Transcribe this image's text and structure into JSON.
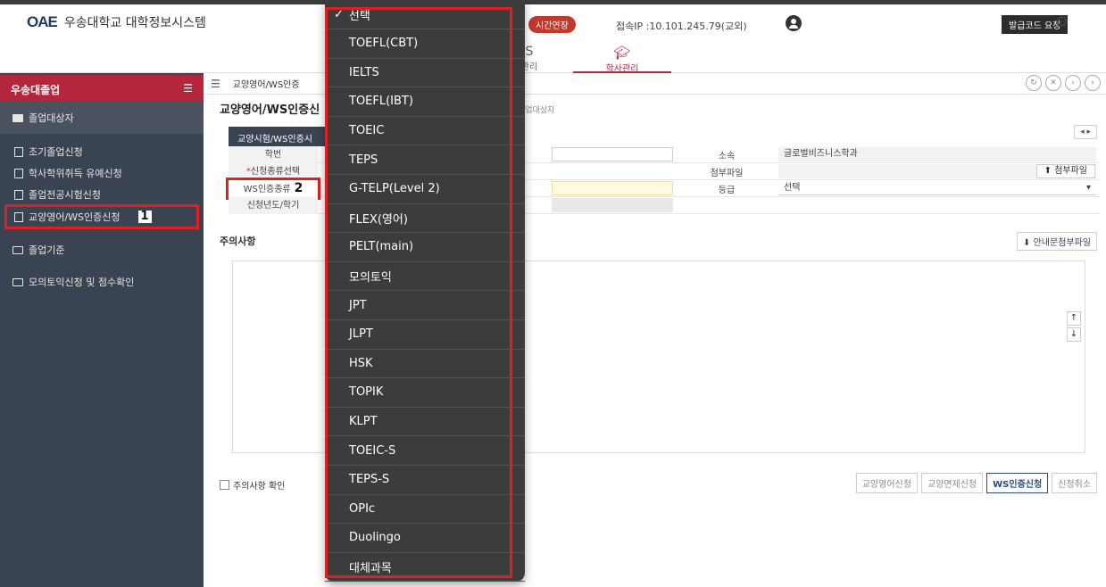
{
  "header": {
    "logo_text": "OAE",
    "app_title": "우송대학교 대학정보시스템",
    "time_extend": "시간연장",
    "ip": "접속IP :10.101.245.79(교외)",
    "code_request": "발급코드 요청"
  },
  "menu": {
    "left_partial_icon": "S",
    "left_partial_label": "관리",
    "active_label": "학사관리"
  },
  "sidebar": {
    "title": "우송대졸업",
    "folder_1": "졸업대상자",
    "items": [
      {
        "label": "조기졸업신청"
      },
      {
        "label": "학사학위취득 유예신청"
      },
      {
        "label": "졸업전공시험신청"
      },
      {
        "label": "교양영어/WS인증신청"
      }
    ],
    "badge_1": "1",
    "folder_2": "졸업기준",
    "folder_3": "모의토익신청 및 점수확인"
  },
  "content": {
    "tab_label": "교양영어/WS인증",
    "page_title": "교양영어/WS인증신",
    "breadcrumb": "졸업대상자",
    "sub_tab": "교양시험/WS인증시",
    "rows": {
      "r1_label": "학번",
      "r1_label2": "소속",
      "r1_value2": "글로벌비즈니스학과",
      "r2_label": "신청종류선택",
      "r2_label2": "첨부파일",
      "r2_button": "⬆ 첨부파일",
      "r3_label": "WS인증종류",
      "r3_badge": "2",
      "r3_label2": "등급",
      "r3_value2": "선택",
      "r4_label": "신청년도/학기"
    },
    "notice_title": "주의사항",
    "notice_file": "⬇ 안내문첨부파일",
    "agree_label": "주의사항 확인",
    "actions": [
      "교양영어신청",
      "교양면제신청",
      "WS인증신청",
      "신청취소"
    ]
  },
  "dropdown": {
    "selected": "선택",
    "options": [
      "TOEFL(CBT)",
      "IELTS",
      "TOEFL(IBT)",
      "TOEIC",
      "TEPS",
      "G-TELP(Level 2)",
      "FLEX(영어)",
      "PELT(main)",
      "모의토익",
      "JPT",
      "JLPT",
      "HSK",
      "TOPIK",
      "KLPT",
      "TOEIC-S",
      "TEPS-S",
      "OPIc",
      "Duolingo",
      "대체과목"
    ]
  }
}
